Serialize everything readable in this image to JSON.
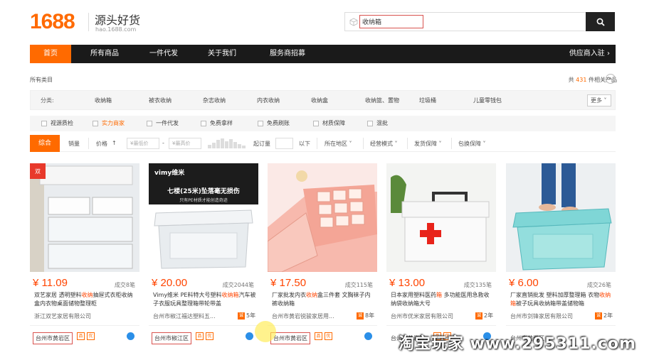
{
  "header": {
    "logo": "1688",
    "slogan": "源头好货",
    "domain": "hao.1688.com",
    "search_value": "收纳箱"
  },
  "nav": {
    "items": [
      "首页",
      "所有商品",
      "一件代发",
      "关于我们",
      "服务商招募"
    ],
    "right": "供应商入驻 ›"
  },
  "breadcrumb": "所有类目",
  "result": {
    "prefix": "共",
    "count": "431",
    "suffix": "件相关产品"
  },
  "categories": {
    "label": "分类:",
    "items": [
      "收纳箱",
      "被衣收纳",
      "杂志收纳",
      "内衣收纳",
      "收纳盒",
      "收纳篮、置物",
      "垃圾桶",
      "儿童零钱包"
    ],
    "more": "更多"
  },
  "filters": [
    "视源质检",
    "实力商家",
    "一件代发",
    "免费拿样",
    "免费刷账",
    "材质保障",
    "混批"
  ],
  "sort": {
    "active": "综合",
    "sales": "销量",
    "price": "价格",
    "price_min": "¥最低价",
    "dash": "-",
    "price_max": "¥最高价",
    "moq": "起订量",
    "below": "以下",
    "location": "所在地区",
    "business": "经营模式",
    "shipping": "发货保障",
    "package": "包换保障"
  },
  "products": [
    {
      "price": "¥ 11.09",
      "deals": "成交8笔",
      "title_pre": "双艺家居 透明塑料",
      "title_hl": "收纳",
      "title_post": "抽屉式衣柜收纳盒内衣物桌面储物整理柜",
      "company": "浙江双艺家居有限公司",
      "years": "",
      "location": "台州市黄岩区"
    },
    {
      "price": "¥ 20.00",
      "deals": "成交2044笔",
      "title_pre": "Vimy维米 PE料特大号塑料",
      "title_hl": "收纳箱",
      "title_post": "汽车被子衣服玩具整理箱带轮带盖",
      "company": "台州市椒江福达塑料五...",
      "years": "5年",
      "location": "台州市椒江区"
    },
    {
      "price": "¥ 17.50",
      "deals": "成交115笔",
      "title_pre": "厂家批发内衣",
      "title_hl": "收纳",
      "title_post": "盒三件套 文胸袜子内裤收纳箱",
      "company": "台州市黄岩锐骏家居用...",
      "years": "8年",
      "location": "台州市黄岩区"
    },
    {
      "price": "¥ 13.00",
      "deals": "成交135笔",
      "title_pre": "日本家用塑料医药",
      "title_hl": "箱",
      "title_post": " 多功能医用急救收纳袋收纳箱大号",
      "company": "台州市优米家居有限公司",
      "years": "2年",
      "location": "台州市黄岩区"
    },
    {
      "price": "¥ 6.00",
      "deals": "成交26笔",
      "title_pre": "厂家直销批发 塑料加厚整理箱 衣物",
      "title_hl": "收纳箱",
      "title_post": "被子玩具收纳箱带盖储物箱",
      "company": "台州市剑锋家居有限公司",
      "years": "2年",
      "location": "台州市黄岩区"
    }
  ],
  "watermark": "淘宝玩家 www.295311.com",
  "colors": {
    "accent": "#ff6a00",
    "nav_bg": "#1a1a1a",
    "price": "#ff4400",
    "highlight_border": "#d9534f"
  }
}
